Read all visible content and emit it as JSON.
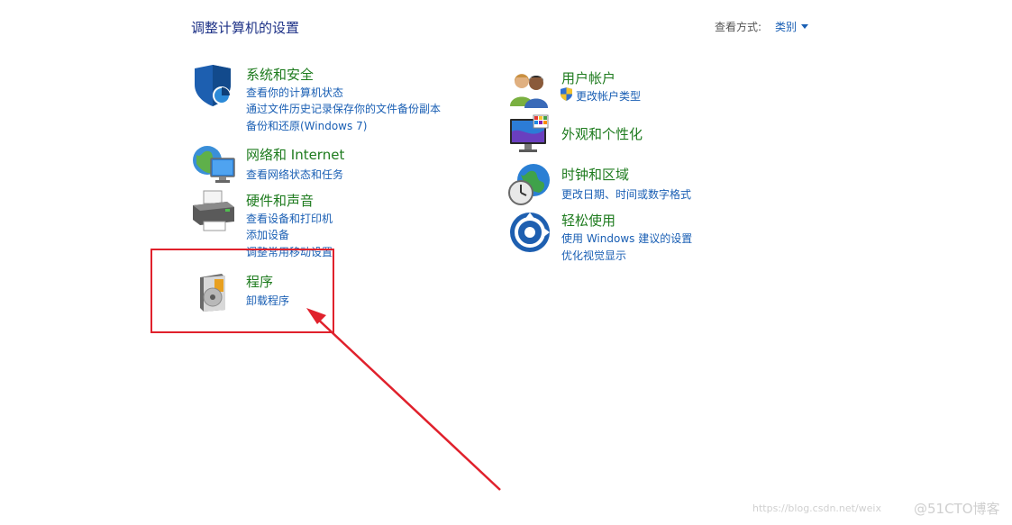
{
  "header": {
    "title": "调整计算机的设置",
    "view_by_label": "查看方式:",
    "view_by_value": "类别"
  },
  "categories": {
    "system_security": {
      "title": "系统和安全",
      "links": [
        "查看你的计算机状态",
        "通过文件历史记录保存你的文件备份副本",
        "备份和还原(Windows 7)"
      ]
    },
    "network": {
      "title": "网络和 Internet",
      "links": [
        "查看网络状态和任务"
      ]
    },
    "hardware": {
      "title": "硬件和声音",
      "links": [
        "查看设备和打印机",
        "添加设备",
        "调整常用移动设置"
      ]
    },
    "programs": {
      "title": "程序",
      "links": [
        "卸载程序"
      ]
    },
    "user_accounts": {
      "title": "用户帐户",
      "links": [
        "更改帐户类型"
      ]
    },
    "appearance": {
      "title": "外观和个性化",
      "links": []
    },
    "clock_region": {
      "title": "时钟和区域",
      "links": [
        "更改日期、时间或数字格式"
      ]
    },
    "ease_of_access": {
      "title": "轻松使用",
      "links": [
        "使用 Windows 建议的设置",
        "优化视觉显示"
      ]
    }
  },
  "icons": {
    "system_security": "shield-icon",
    "network": "globe-monitor-icon",
    "hardware": "printer-icon",
    "programs": "programs-disc-icon",
    "user_accounts": "users-icon",
    "appearance": "monitor-colors-icon",
    "clock_region": "clock-globe-icon",
    "ease_of_access": "ease-access-icon",
    "uac": "uac-shield-icon"
  },
  "colors": {
    "title_green": "#1e7b1e",
    "link_blue": "#1a5fb4",
    "annotation_red": "#e0212c"
  },
  "watermark": {
    "text1": "https://blog.csdn.net/weix",
    "text2": "@51CTO博客"
  }
}
